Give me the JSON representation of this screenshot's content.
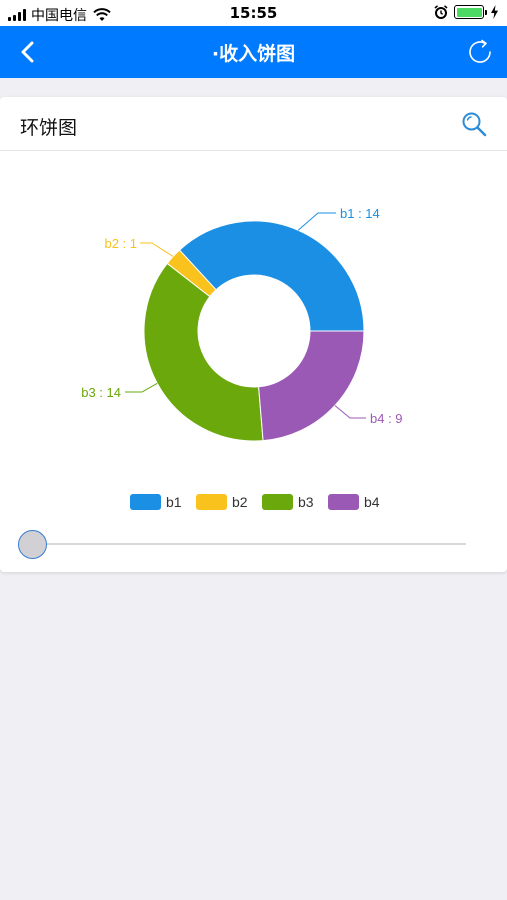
{
  "status_bar": {
    "carrier": "中国电信",
    "time": "15:55"
  },
  "nav": {
    "title": "·收入饼图",
    "back_icon": "chevron-left-icon",
    "refresh_icon": "refresh-icon",
    "background": "#007aff"
  },
  "card": {
    "title": "环饼图",
    "search_icon": "search-icon"
  },
  "chart_data": {
    "type": "pie",
    "variant": "donut",
    "categories": [
      "b1",
      "b2",
      "b3",
      "b4"
    ],
    "values": [
      14,
      1,
      14,
      9
    ],
    "data_labels": [
      "b1 : 14",
      "b2 : 1",
      "b3 : 14",
      "b4 : 9"
    ],
    "colors": [
      "#1a8fe3",
      "#fac21c",
      "#6aa80b",
      "#9b59b6"
    ],
    "legend": [
      "b1",
      "b2",
      "b3",
      "b4"
    ],
    "legend_position": "bottom"
  },
  "slider": {
    "value": 0
  }
}
